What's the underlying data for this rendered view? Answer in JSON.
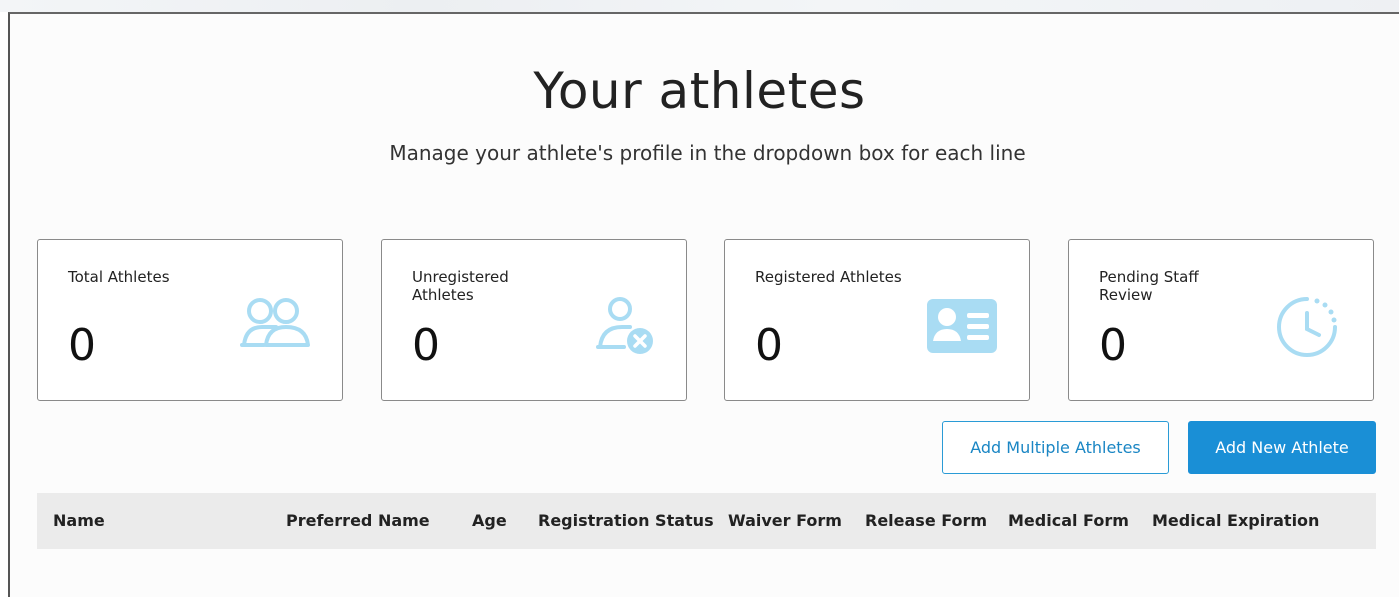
{
  "page": {
    "title": "Your athletes",
    "subtitle": "Manage your athlete's profile in the dropdown box for each line"
  },
  "cards": [
    {
      "label": "Total Athletes",
      "value": "0",
      "icon": "users-icon"
    },
    {
      "label": "Unregistered Athletes",
      "value": "0",
      "icon": "user-remove-icon"
    },
    {
      "label": "Registered Athletes",
      "value": "0",
      "icon": "id-card-icon"
    },
    {
      "label": "Pending Staff Review",
      "value": "0",
      "icon": "clock-icon"
    }
  ],
  "actions": {
    "add_multiple_label": "Add Multiple Athletes",
    "add_new_label": "Add New Athlete"
  },
  "table": {
    "columns": [
      "Name",
      "Preferred Name",
      "Age",
      "Registration Status",
      "Waiver Form",
      "Release Form",
      "Medical Form",
      "Medical Expiration"
    ]
  },
  "colors": {
    "accent": "#1a8fd6",
    "icon_light": "#a9dcf3",
    "header_bg": "#ebebeb"
  }
}
